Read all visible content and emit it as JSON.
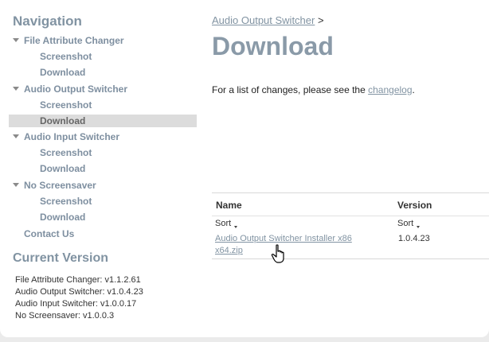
{
  "sidebar": {
    "heading": "Navigation",
    "groups": [
      {
        "label": "File Attribute Changer",
        "items": [
          "Screenshot",
          "Download"
        ]
      },
      {
        "label": "Audio Output Switcher",
        "items": [
          "Screenshot",
          "Download"
        ]
      },
      {
        "label": "Audio Input Switcher",
        "items": [
          "Screenshot",
          "Download"
        ]
      },
      {
        "label": "No Screensaver",
        "items": [
          "Screenshot",
          "Download"
        ]
      }
    ],
    "contact": "Contact Us",
    "selected": "Audio Output Switcher / Download"
  },
  "current_version": {
    "heading": "Current Version",
    "lines": [
      "File Attribute Changer: v1.1.2.61",
      "Audio Output Switcher: v1.0.4.23",
      "Audio Input Switcher: v1.0.0.17",
      "No Screensaver: v1.0.0.3"
    ]
  },
  "main": {
    "breadcrumb": {
      "link": "Audio Output Switcher",
      "separator": ">"
    },
    "title": "Download",
    "intro_prefix": "For a list of changes, please see the ",
    "intro_link": "changelog",
    "intro_suffix": ".",
    "table": {
      "columns": [
        "Name",
        "Version"
      ],
      "sort_label": "Sort",
      "rows": [
        {
          "name": "Audio Output Switcher Installer x86 x64.zip",
          "version": "1.0.4.23"
        }
      ]
    }
  },
  "colors": {
    "accent": "#8193a2",
    "title": "#8a9aa8",
    "highlight": "#dcdcdc",
    "page_bg": "#ebebeb"
  }
}
